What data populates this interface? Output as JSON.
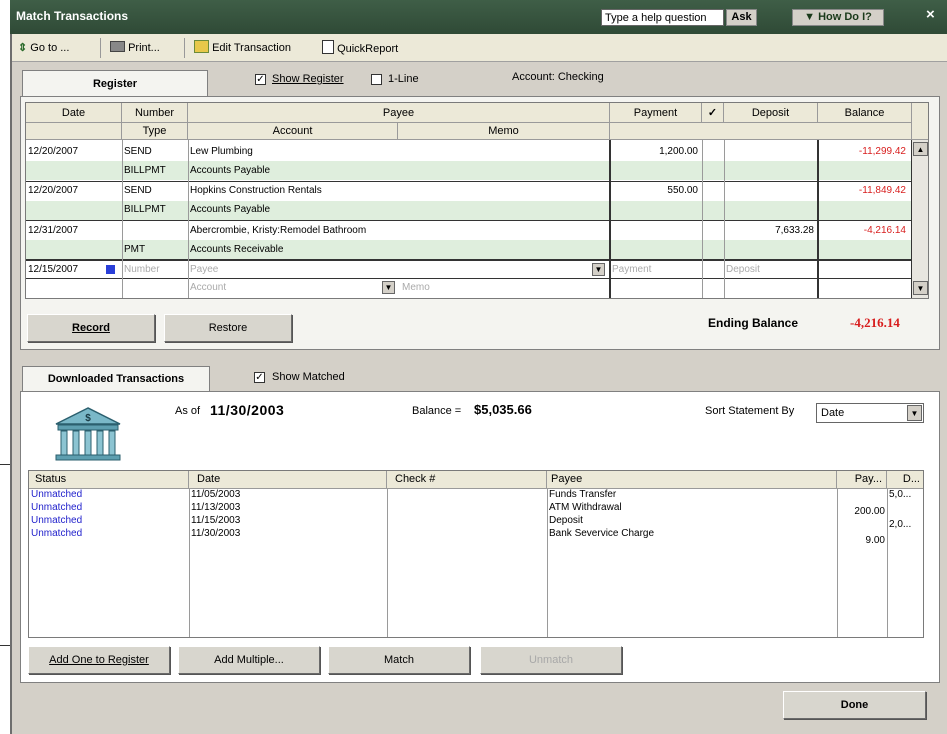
{
  "window": {
    "title": "Match Transactions",
    "help_placeholder": "Type a help question",
    "ask_label": "Ask",
    "how_do_i_label": "▼ How Do I?",
    "close_label": "×"
  },
  "toolbar": {
    "goto": "Go to ...",
    "print": "Print...",
    "edit": "Edit Transaction",
    "quickreport": "QuickReport"
  },
  "register": {
    "tab_label": "Register",
    "show_register_label": "Show Register",
    "one_line_label": "1-Line",
    "account_label": "Account: Checking",
    "headers": {
      "date": "Date",
      "number": "Number",
      "type": "Type",
      "payee": "Payee",
      "account": "Account",
      "memo": "Memo",
      "payment": "Payment",
      "check": "✓",
      "deposit": "Deposit",
      "balance": "Balance"
    },
    "rows": [
      {
        "date": "12/20/2007",
        "number": "SEND",
        "type": "BILLPMT",
        "payee": "Lew Plumbing",
        "account": "Accounts Payable",
        "payment": "1,200.00",
        "deposit": "",
        "balance": "-11,299.42"
      },
      {
        "date": "12/20/2007",
        "number": "SEND",
        "type": "BILLPMT",
        "payee": "Hopkins Construction Rentals",
        "account": "Accounts Payable",
        "payment": "550.00",
        "deposit": "",
        "balance": "-11,849.42"
      },
      {
        "date": "12/31/2007",
        "number": "",
        "type": "PMT",
        "payee": "Abercrombie, Kristy:Remodel Bathroom",
        "account": "Accounts Receivable",
        "payment": "",
        "deposit": "7,633.28",
        "balance": "-4,216.14"
      }
    ],
    "entry": {
      "date": "12/15/2007",
      "number_ph": "Number",
      "payee_ph": "Payee",
      "payment_ph": "Payment",
      "deposit_ph": "Deposit",
      "account_ph": "Account",
      "memo_ph": "Memo"
    },
    "record_label": "Record",
    "restore_label": "Restore",
    "ending_balance_label": "Ending Balance",
    "ending_balance_value": "-4,216.14"
  },
  "downloaded": {
    "tab_label": "Downloaded Transactions",
    "show_matched_label": "Show Matched",
    "as_of_label": "As of",
    "as_of_date": "11/30/2003",
    "balance_label": "Balance =",
    "balance_value": "$5,035.66",
    "sort_label": "Sort Statement By",
    "sort_value": "Date",
    "headers": {
      "status": "Status",
      "date": "Date",
      "check": "Check #",
      "payee": "Payee",
      "pay": "Pay...",
      "dep": "D..."
    },
    "rows": [
      {
        "status": "Unmatched",
        "date": "11/05/2003",
        "payee": "Funds Transfer",
        "pay": "",
        "dep": "5,0..."
      },
      {
        "status": "Unmatched",
        "date": "11/13/2003",
        "payee": "ATM Withdrawal",
        "pay": "200.00",
        "dep": ""
      },
      {
        "status": "Unmatched",
        "date": "11/15/2003",
        "payee": "Deposit",
        "pay": "",
        "dep": "2,0..."
      },
      {
        "status": "Unmatched",
        "date": "11/30/2003",
        "payee": "Bank Severvice Charge",
        "pay": "9.00",
        "dep": ""
      }
    ],
    "add_one_label": "Add One to Register",
    "add_multiple_label": "Add Multiple...",
    "match_label": "Match",
    "unmatch_label": "Unmatch"
  },
  "done_label": "Done",
  "colors": {
    "title_bg": "#2f4a36",
    "negative": "#d81e1e",
    "link": "#2222cc",
    "row_alt": "#dfeedd"
  }
}
